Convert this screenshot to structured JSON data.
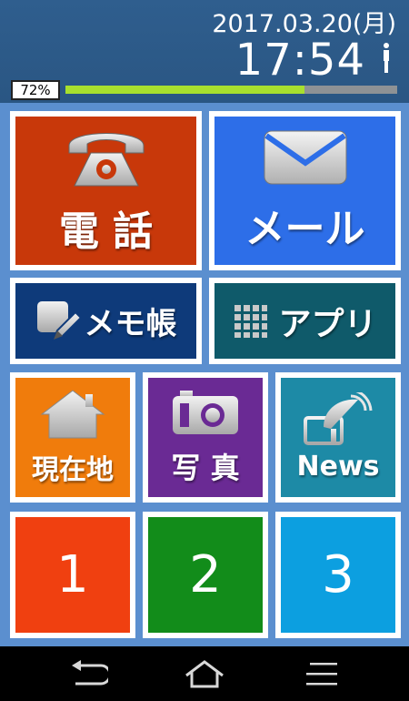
{
  "status": {
    "date": "2017.03.20(月)",
    "time": "17:54",
    "battery": "72%",
    "progress": 0.72
  },
  "tiles": {
    "phone": {
      "label": "電 話",
      "color": "#c8380a"
    },
    "mail": {
      "label": "メール",
      "color": "#2d6ee8"
    },
    "memo": {
      "label": "メモ帳",
      "color": "#0e3a7a"
    },
    "apps": {
      "label": "アプリ",
      "color": "#0f5a6a"
    },
    "location": {
      "label": "現在地",
      "color": "#f07c0c"
    },
    "photo": {
      "label": "写 真",
      "color": "#6a2a94"
    },
    "news": {
      "label": "News",
      "color": "#1d8aa6"
    },
    "shortcut1": {
      "label": "1",
      "color": "#f04010"
    },
    "shortcut2": {
      "label": "2",
      "color": "#128c1a"
    },
    "shortcut3": {
      "label": "3",
      "color": "#0c9fe0"
    }
  },
  "nav": {
    "back": "back-icon",
    "home": "home-icon",
    "menu": "menu-icon"
  }
}
